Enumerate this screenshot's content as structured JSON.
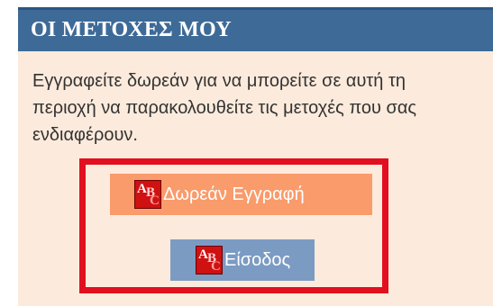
{
  "panel": {
    "title": "ΟΙ ΜΕΤΟΧΕΣ ΜΟΥ",
    "description": "Εγγραφείτε δωρεάν για να μπορείτε σε αυτή τη περιοχή να παρακολουθείτε τις μετοχές που σας ενδιαφέρουν."
  },
  "buttons": {
    "register_label": "Δωρεάν Εγγραφή",
    "login_label": "Είσοδος"
  },
  "icons": {
    "button_icon": "abc-icon"
  },
  "colors": {
    "header_bg": "#3e6a98",
    "panel_bg": "#fcebdc",
    "register_bg": "#f99b6b",
    "login_bg": "#7b9bc3",
    "highlight": "#e10f1f"
  }
}
